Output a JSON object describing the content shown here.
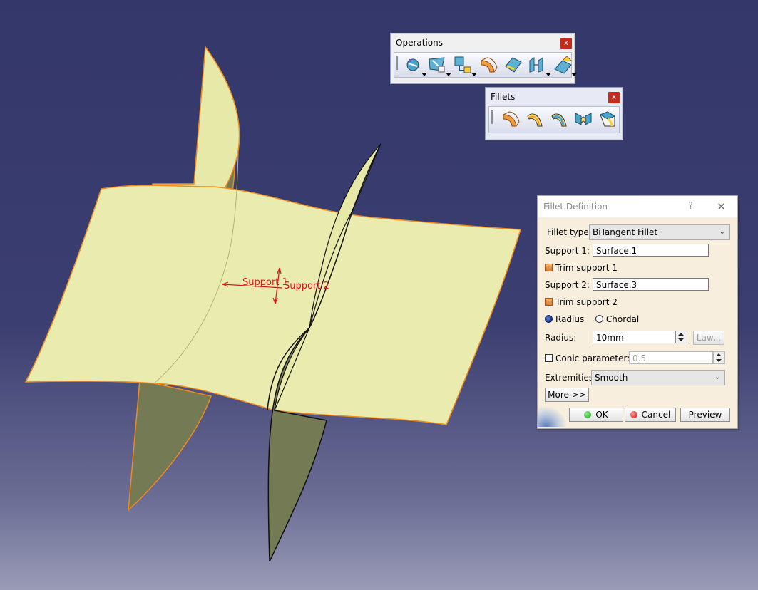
{
  "viewport": {
    "annotations": {
      "support1": "Support 1",
      "support2": "Support 2"
    }
  },
  "toolbars": {
    "operations": {
      "title": "Operations",
      "close": "x",
      "icons": [
        "join-healing-icon",
        "split-trim-icon",
        "extract-icon",
        "shape-fillet-icon",
        "edge-fillet-icon",
        "translate-icon",
        "extrapolate-icon"
      ]
    },
    "fillets": {
      "title": "Fillets",
      "close": "x",
      "icons": [
        "shape-fillet-icon",
        "edge-fillet-icon",
        "variable-fillet-icon",
        "face-face-fillet-icon",
        "tritangent-fillet-icon"
      ]
    }
  },
  "dialog": {
    "title": "Fillet Definition",
    "help": "?",
    "close": "✕",
    "fillet_type_label": "Fillet type:",
    "fillet_type_value": "BiTangent Fillet",
    "support1_label": "Support 1:",
    "support1_value": "Surface.1",
    "trim_support1_label": "Trim support 1",
    "trim_support1_checked": true,
    "support2_label": "Support 2:",
    "support2_value": "Surface.3",
    "trim_support2_label": "Trim support 2",
    "trim_support2_checked": true,
    "radius_option": "Radius",
    "chordal_option": "Chordal",
    "selected_option": "Radius",
    "radius_label": "Radius:",
    "radius_value": "10mm",
    "law_button": "Law...",
    "conic_label": "Conic parameter:",
    "conic_checked": false,
    "conic_value": "0.5",
    "extremities_label": "Extremities:",
    "extremities_value": "Smooth",
    "more_button": "More >>",
    "ok_button": "OK",
    "cancel_button": "Cancel",
    "preview_button": "Preview"
  },
  "colors": {
    "background_top": "#34376a",
    "background_bottom": "#9a9bb6",
    "surface_fill": "#eef0b4",
    "surface_shade": "#7a7f58",
    "edge_highlight": "#f08a1c",
    "annotation": "#e0131a"
  }
}
